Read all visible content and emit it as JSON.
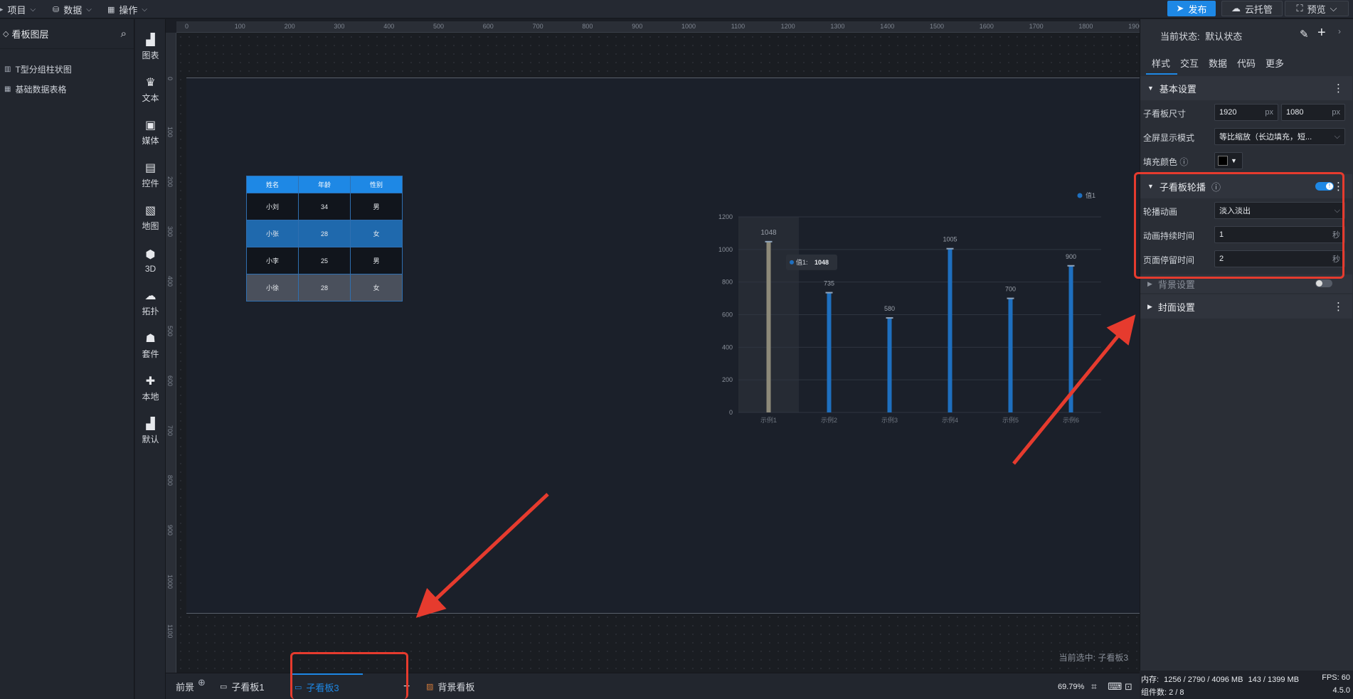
{
  "topbar": {
    "menus": [
      {
        "label": "项目"
      },
      {
        "label": "数据"
      },
      {
        "label": "操作"
      }
    ],
    "publish_label": "发布",
    "cloud_label": "云托管",
    "preview_label": "预览"
  },
  "layers": {
    "title": "看板图层",
    "items": [
      {
        "label": "T型分组柱状图"
      },
      {
        "label": "基础数据表格"
      }
    ]
  },
  "toolbox": {
    "items": [
      {
        "label": "图表",
        "icon": "bar-chart-icon"
      },
      {
        "label": "文本",
        "icon": "text-icon"
      },
      {
        "label": "媒体",
        "icon": "media-icon"
      },
      {
        "label": "控件",
        "icon": "widget-icon"
      },
      {
        "label": "地图",
        "icon": "map-icon"
      },
      {
        "label": "3D",
        "icon": "cube-icon"
      },
      {
        "label": "拓扑",
        "icon": "topology-icon"
      },
      {
        "label": "套件",
        "icon": "kit-icon"
      },
      {
        "label": "本地",
        "icon": "puzzle-icon"
      },
      {
        "label": "默认",
        "icon": "default-chart-icon"
      }
    ]
  },
  "ruler": {
    "h_labels": [
      "0",
      "100",
      "200",
      "300",
      "400",
      "500",
      "600",
      "700",
      "800",
      "900",
      "1000",
      "1100",
      "1200",
      "1300",
      "1400",
      "1500",
      "1600",
      "1700",
      "1800",
      "1900"
    ],
    "v_labels": [
      "0",
      "100",
      "200",
      "300",
      "400",
      "500",
      "600",
      "700",
      "800",
      "900",
      "1000",
      "1100"
    ]
  },
  "table": {
    "headers": [
      "姓名",
      "年龄",
      "性别"
    ],
    "rows": [
      [
        "小刘",
        "34",
        "男"
      ],
      [
        "小张",
        "28",
        "女"
      ],
      [
        "小李",
        "25",
        "男"
      ],
      [
        "小徐",
        "28",
        "女"
      ]
    ]
  },
  "chart_data": {
    "type": "bar",
    "categories": [
      "示例1",
      "示例2",
      "示例3",
      "示例4",
      "示例5",
      "示例6"
    ],
    "series": [
      {
        "name": "值1",
        "values": [
          1048,
          735,
          580,
          1005,
          700,
          900
        ]
      }
    ],
    "ylim": [
      0,
      1200
    ],
    "yticks": [
      0,
      200,
      400,
      600,
      800,
      1000,
      1200
    ],
    "legend_position": "top-right",
    "tooltip": {
      "series": "值1:",
      "value": "1048"
    },
    "colors": {
      "bar": "#1e6fbf",
      "highlight": "#8d8a79"
    }
  },
  "canvas": {
    "selected_text": "当前选中: 子看板3"
  },
  "bottom": {
    "foreground_label": "前景",
    "tabs": [
      {
        "label": "子看板1"
      },
      {
        "label": "子看板3"
      }
    ],
    "bg_label": "背景看板",
    "zoom": "69.79%"
  },
  "status": {
    "memory_label": "内存:",
    "memory_value": "1256 / 2790 / 4096 MB",
    "memory_extra": "143 / 1399 MB",
    "fps_label": "FPS:",
    "fps_value": "60",
    "components_label": "组件数: 2 / 8",
    "version": "4.5.0"
  },
  "panel": {
    "state_label": "当前状态:",
    "state_value": "默认状态",
    "tabs": [
      "样式",
      "交互",
      "数据",
      "代码",
      "更多"
    ],
    "basic": {
      "title": "基本设置",
      "size_label": "子看板尺寸",
      "width": "1920",
      "height": "1080",
      "unit": "px",
      "fullscreen_label": "全屏显示模式",
      "fullscreen_value": "等比缩放（长边填充，短...",
      "fill_label": "填充颜色"
    },
    "carousel": {
      "title": "子看板轮播",
      "toggle_text": "!",
      "anim_label": "轮播动画",
      "anim_value": "淡入淡出",
      "duration_label": "动画持续时间",
      "duration_value": "1",
      "stay_label": "页面停留时间",
      "stay_value": "2",
      "unit": "秒"
    },
    "bg_title": "背景设置",
    "cover_title": "封面设置"
  },
  "colors": {
    "accent": "#1e88e5",
    "annotation": "#e63b2e"
  }
}
